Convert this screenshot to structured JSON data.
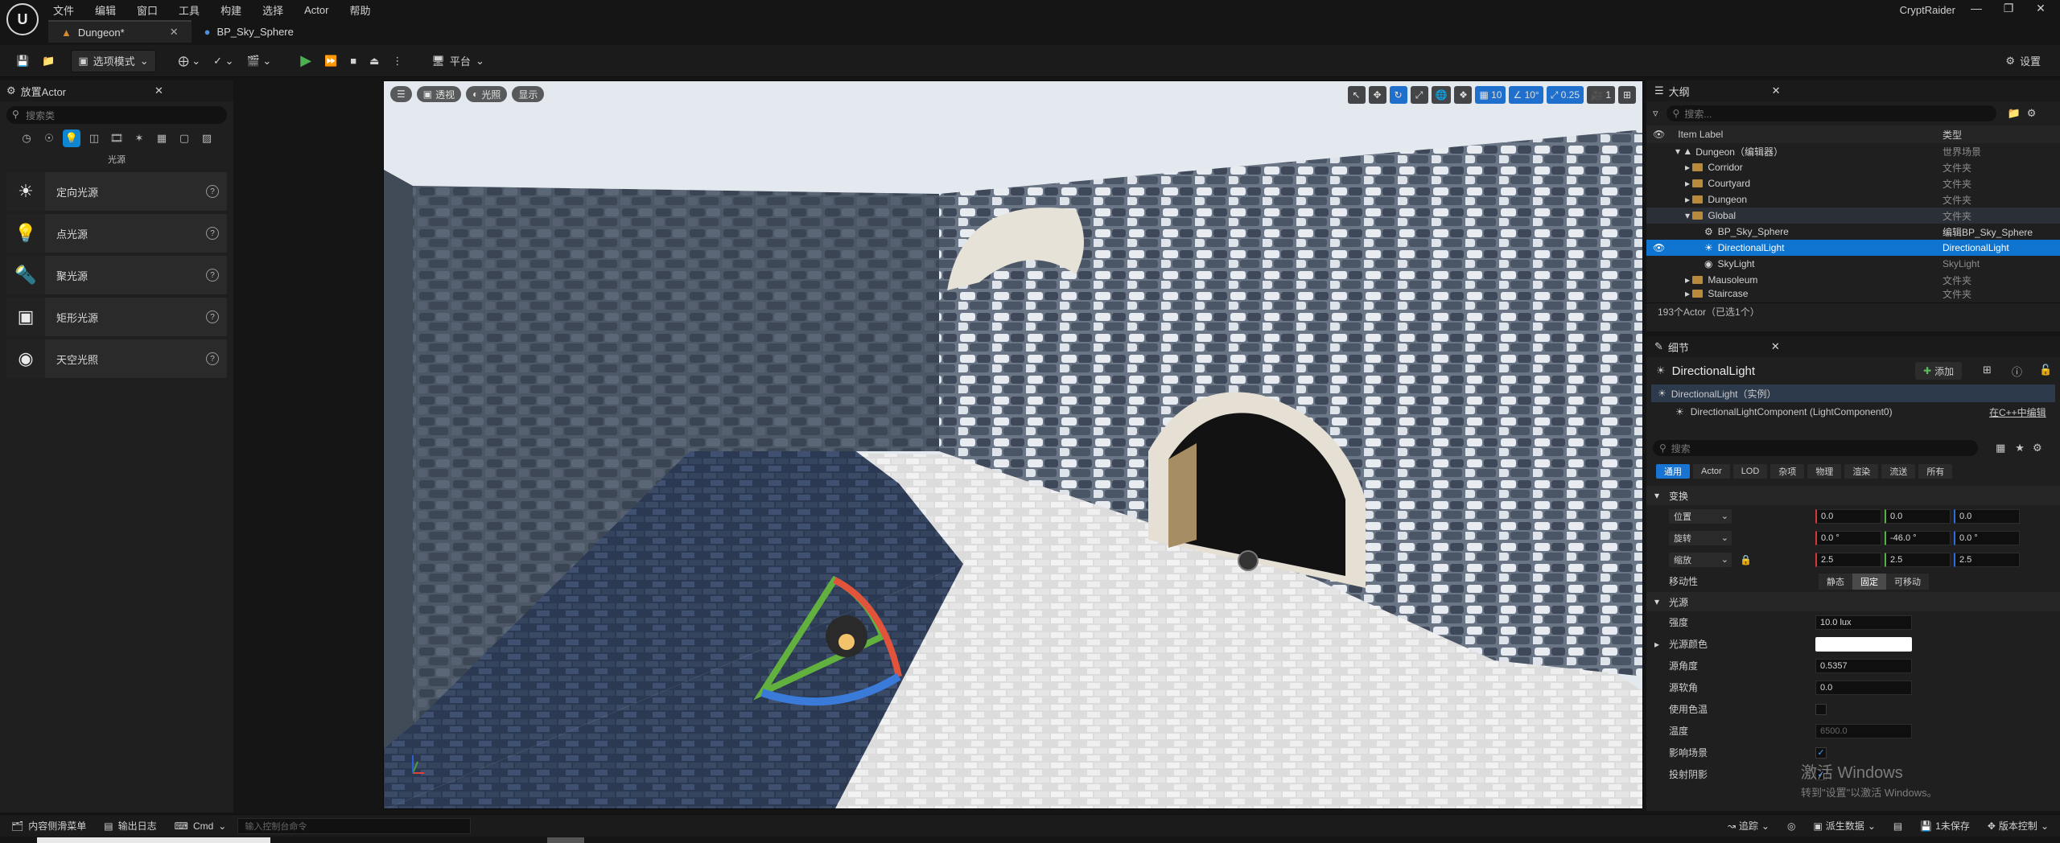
{
  "app": {
    "name": "CryptRaider"
  },
  "menu": [
    "文件",
    "编辑",
    "窗口",
    "工具",
    "构建",
    "选择",
    "Actor",
    "帮助"
  ],
  "tabs": [
    {
      "label": "Dungeon*"
    },
    {
      "label": "BP_Sky_Sphere"
    }
  ],
  "toolbar": {
    "select_mode": "选项模式",
    "platform": "平台",
    "settings": "设置"
  },
  "left_panel": {
    "title": "放置Actor",
    "search_placeholder": "搜索类",
    "category_label": "光源",
    "items": [
      {
        "label": "定向光源",
        "icon": "directional-light-icon"
      },
      {
        "label": "点光源",
        "icon": "point-light-icon"
      },
      {
        "label": "聚光源",
        "icon": "spot-light-icon"
      },
      {
        "label": "矩形光源",
        "icon": "rect-light-icon"
      },
      {
        "label": "天空光照",
        "icon": "sky-light-icon"
      }
    ]
  },
  "viewport": {
    "view_mode": "透视",
    "lighting": "光照",
    "show": "显示",
    "grid_snap": "10",
    "rot_snap": "10°",
    "scale_snap": "0.25",
    "camera_speed": "1"
  },
  "outliner": {
    "title": "大纲",
    "search_placeholder": "搜索...",
    "col_label": "Item Label",
    "col_type": "类型",
    "rows": [
      {
        "label": "Dungeon（编辑器）",
        "type": "世界场景",
        "indent": 1,
        "kind": "world"
      },
      {
        "label": "Corridor",
        "type": "文件夹",
        "indent": 2,
        "kind": "folder"
      },
      {
        "label": "Courtyard",
        "type": "文件夹",
        "indent": 2,
        "kind": "folder"
      },
      {
        "label": "Dungeon",
        "type": "文件夹",
        "indent": 2,
        "kind": "folder"
      },
      {
        "label": "Global",
        "type": "文件夹",
        "indent": 2,
        "kind": "folder"
      },
      {
        "label": "BP_Sky_Sphere",
        "type": "编辑BP_Sky_Sphere",
        "indent": 3,
        "kind": "actor"
      },
      {
        "label": "DirectionalLight",
        "type": "DirectionalLight",
        "indent": 3,
        "kind": "actor",
        "selected": true
      },
      {
        "label": "SkyLight",
        "type": "SkyLight",
        "indent": 3,
        "kind": "actor"
      },
      {
        "label": "Mausoleum",
        "type": "文件夹",
        "indent": 2,
        "kind": "folder"
      },
      {
        "label": "Staircase",
        "type": "文件夹",
        "indent": 2,
        "kind": "folder"
      }
    ],
    "status": "193个Actor（已选1个）"
  },
  "details": {
    "title": "细节",
    "actor_name": "DirectionalLight",
    "add_label": "添加",
    "instance_label": "DirectionalLight（实例）",
    "component_label": "DirectionalLightComponent (LightComponent0)",
    "cpp_link": "在C++中编辑",
    "search_placeholder": "搜索",
    "filter_tabs": [
      "通用",
      "Actor",
      "LOD",
      "杂项",
      "物理",
      "渲染",
      "流送",
      "所有"
    ],
    "transform_section": "变换",
    "location": {
      "label": "位置",
      "x": "0.0",
      "y": "0.0",
      "z": "0.0"
    },
    "rotation": {
      "label": "旋转",
      "x": "0.0 °",
      "y": "-46.0 °",
      "z": "0.0 °"
    },
    "scale": {
      "label": "缩放",
      "x": "2.5",
      "y": "2.5",
      "z": "2.5"
    },
    "mobility": {
      "label": "移动性",
      "options": [
        "静态",
        "固定",
        "可移动"
      ]
    },
    "light_section": "光源",
    "intensity": {
      "label": "强度",
      "value": "10.0 lux"
    },
    "light_color": {
      "label": "光源颜色"
    },
    "source_angle": {
      "label": "源角度",
      "value": "0.5357"
    },
    "source_soft_angle": {
      "label": "源软角",
      "value": "0.0"
    },
    "use_temperature": {
      "label": "使用色温"
    },
    "temperature": {
      "label": "温度",
      "value": "6500.0"
    },
    "affects_world": {
      "label": "影响场景"
    },
    "cast_shadows": {
      "label": "投射阴影"
    }
  },
  "bottom": {
    "content_drawer": "内容侧滑菜单",
    "output_log": "输出日志",
    "cmd": "Cmd",
    "console_placeholder": "输入控制台命令",
    "trace": "追踪",
    "derived_data": "派生数据",
    "unsaved": "1未保存",
    "version_control": "版本控制"
  },
  "watermark": {
    "line1": "激活 Windows",
    "line2": "转到\"设置\"以激活 Windows。"
  },
  "colors": {
    "accent": "#0e74d0",
    "background": "#151515",
    "panel": "#1f1f1f"
  }
}
